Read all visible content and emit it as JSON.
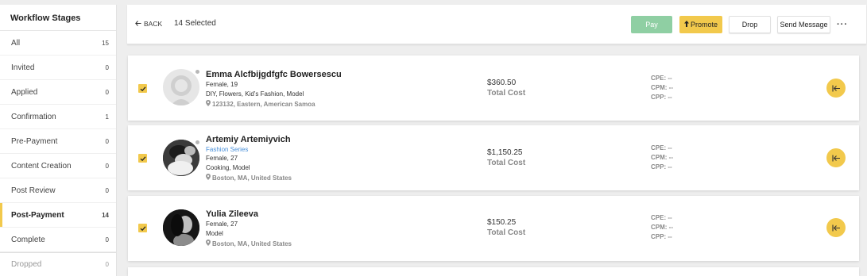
{
  "sidebar": {
    "title": "Workflow Stages",
    "stages": [
      {
        "label": "All",
        "count": "15"
      },
      {
        "label": "Invited",
        "count": "0"
      },
      {
        "label": "Applied",
        "count": "0"
      },
      {
        "label": "Confirmation",
        "count": "1"
      },
      {
        "label": "Pre-Payment",
        "count": "0"
      },
      {
        "label": "Content Creation",
        "count": "0"
      },
      {
        "label": "Post Review",
        "count": "0"
      },
      {
        "label": "Post-Payment",
        "count": "14",
        "active": true
      },
      {
        "label": "Complete",
        "count": "0"
      },
      {
        "label": "Dropped",
        "count": "0"
      }
    ]
  },
  "toolbar": {
    "back_label": "BACK",
    "selected_text": "14 Selected",
    "pay_label": "Pay",
    "promote_label": "Promote",
    "drop_label": "Drop",
    "send_message_label": "Send Message",
    "more_label": "···"
  },
  "colors": {
    "accent": "#f2c94c",
    "pay": "#8fcfa3",
    "link": "#4a90d9"
  },
  "creators": [
    {
      "name": "Emma Alcfbijgdfgfc Bowersescu",
      "series": "",
      "demographics": "Female, 19",
      "categories": "DIY, Flowers, Kid’s Fashion, Model",
      "location": "123132, Eastern, American Samoa",
      "cost_amount": "$360.50",
      "cost_label": "Total Cost",
      "cpe": "CPE: --",
      "cpm": "CPM: --",
      "cpp": "CPP: --",
      "checked": true
    },
    {
      "name": "Artemiy Artemiyvich",
      "series": "Fashion Series",
      "demographics": "Female, 27",
      "categories": "Cooking, Model",
      "location": "Boston, MA, United States",
      "cost_amount": "$1,150.25",
      "cost_label": "Total Cost",
      "cpe": "CPE: --",
      "cpm": "CPM: --",
      "cpp": "CPP: --",
      "checked": true
    },
    {
      "name": "Yulia Zileeva",
      "series": "",
      "demographics": "Female, 27",
      "categories": "Model",
      "location": "Boston, MA, United States",
      "cost_amount": "$150.25",
      "cost_label": "Total Cost",
      "cpe": "CPE: --",
      "cpm": "CPM: --",
      "cpp": "CPP: --",
      "checked": true
    }
  ]
}
